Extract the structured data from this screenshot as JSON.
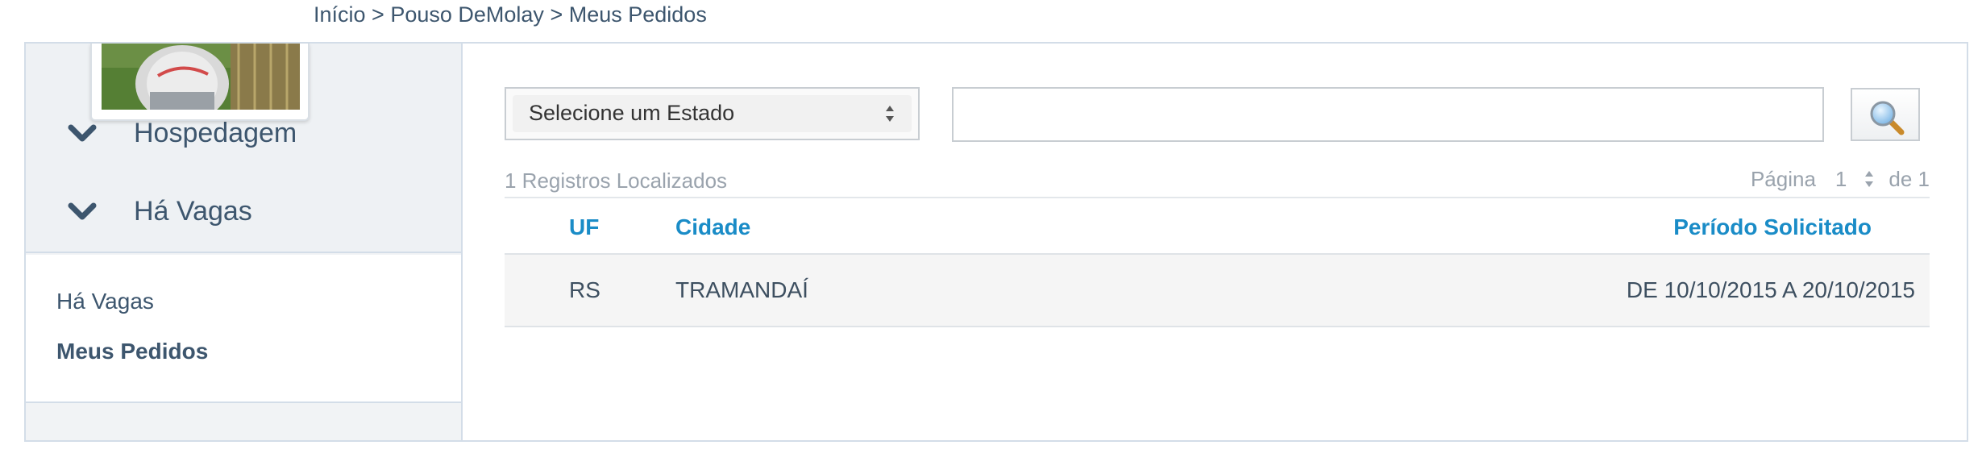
{
  "breadcrumb": {
    "home": "Início",
    "sep1": " > ",
    "section": "Pouso DeMolay",
    "sep2": " > ",
    "current": "Meus Pedidos"
  },
  "sidebar": {
    "nav": [
      {
        "label": "Hospedagem",
        "icon": "chevron-down-icon"
      },
      {
        "label": "Há Vagas",
        "icon": "chevron-down-icon"
      }
    ],
    "submenu": [
      {
        "label": "Há Vagas",
        "active": false
      },
      {
        "label": "Meus Pedidos",
        "active": true
      }
    ]
  },
  "filters": {
    "state_select_value": "Selecione um Estado",
    "search_value": "",
    "search_icon": "magnifier-icon"
  },
  "results": {
    "count_text": "1 Registros Localizados",
    "page_label": "Página",
    "page_value": "1",
    "page_total": "de 1"
  },
  "table": {
    "columns": [
      "UF",
      "Cidade",
      "Período Solicitado"
    ],
    "rows": [
      [
        "RS",
        "TRAMANDAÍ",
        "DE 10/10/2015 A 20/10/2015"
      ]
    ]
  },
  "colors": {
    "accent": "#1a8cc7",
    "text": "#3d566e",
    "border": "#d3dde8",
    "muted": "#9aa3ad"
  }
}
